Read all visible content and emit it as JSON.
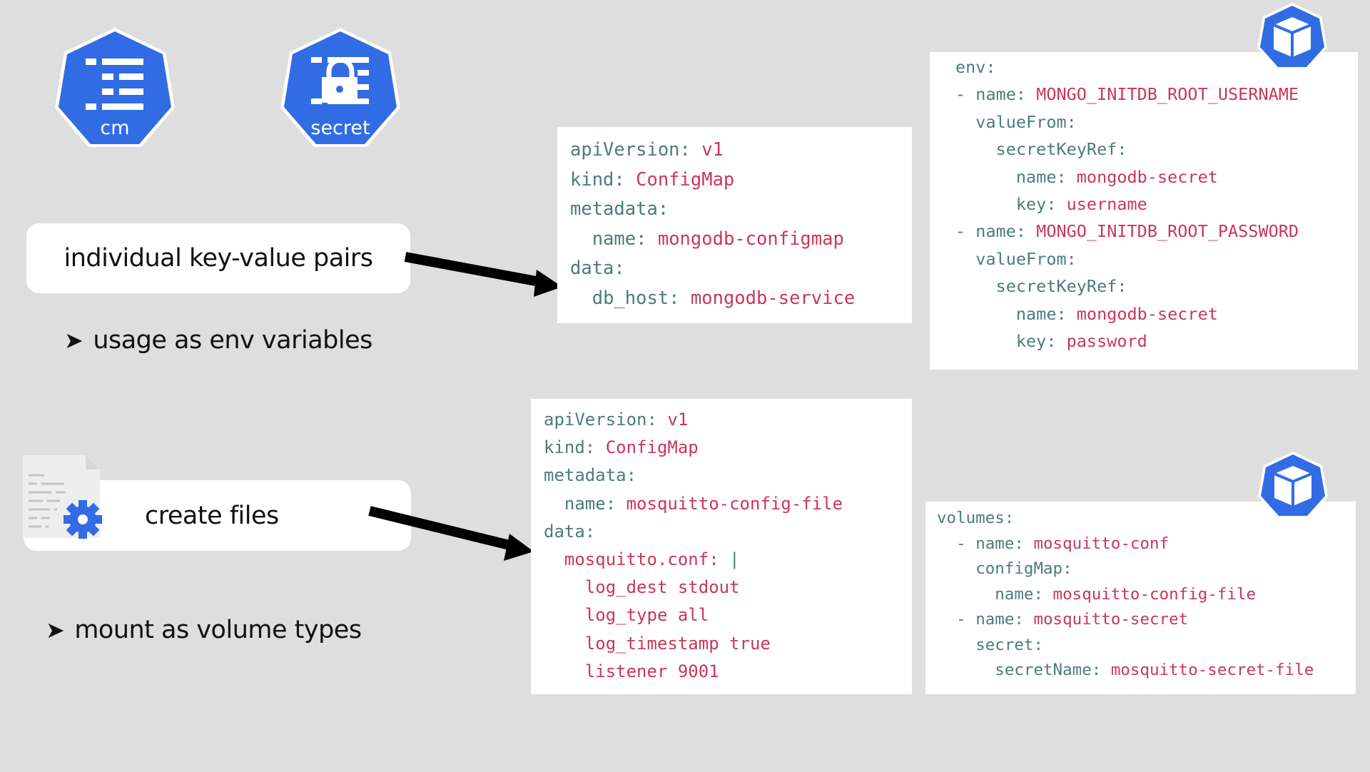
{
  "icons": {
    "configmap": {
      "label": "cm",
      "icon": "configmap-icon"
    },
    "secret": {
      "label": "secret",
      "icon": "secret-lock-icon"
    },
    "pod_top": {
      "icon": "pod-cube-icon"
    },
    "pod_bottom": {
      "icon": "pod-cube-icon"
    },
    "file_gear": {
      "icon": "config-file-gear-icon"
    }
  },
  "colors": {
    "background": "#dedede",
    "k8s_blue": "#326ce5",
    "yaml_key": "#4d7c77",
    "yaml_value": "#c8375c",
    "arrow": "#000000"
  },
  "sections": {
    "key_value": {
      "pill_label": "individual key-value pairs",
      "bullet_marker": "➤",
      "bullet_text": "usage as env variables"
    },
    "files": {
      "pill_label": "create files",
      "bullet_marker": "➤",
      "bullet_text": "mount as volume types"
    }
  },
  "code_blocks": {
    "configmap_kv": [
      {
        "indent": "",
        "key": "apiVersion:",
        "value": " v1"
      },
      {
        "indent": "",
        "key": "kind:",
        "value": " ConfigMap"
      },
      {
        "indent": "",
        "key": "metadata:",
        "value": ""
      },
      {
        "indent": "  ",
        "key": "name:",
        "value": " mongodb-configmap"
      },
      {
        "indent": "",
        "key": "data:",
        "value": ""
      },
      {
        "indent": "  ",
        "key": "db_host:",
        "value": " mongodb-service"
      }
    ],
    "env": [
      {
        "indent": "",
        "key": "env:",
        "value": ""
      },
      {
        "indent": "- ",
        "key": "name:",
        "value": " MONGO_INITDB_ROOT_USERNAME"
      },
      {
        "indent": "  ",
        "key": "valueFrom:",
        "value": ""
      },
      {
        "indent": "    ",
        "key": "secretKeyRef:",
        "value": ""
      },
      {
        "indent": "      ",
        "key": "name:",
        "value": " mongodb-secret"
      },
      {
        "indent": "      ",
        "key": "key:",
        "value": " username"
      },
      {
        "indent": "- ",
        "key": "name:",
        "value": " MONGO_INITDB_ROOT_PASSWORD"
      },
      {
        "indent": "  ",
        "key": "valueFrom:",
        "value": ""
      },
      {
        "indent": "    ",
        "key": "secretKeyRef:",
        "value": ""
      },
      {
        "indent": "      ",
        "key": "name:",
        "value": " mongodb-secret"
      },
      {
        "indent": "      ",
        "key": "key:",
        "value": " password"
      }
    ],
    "configmap_file": [
      {
        "indent": "",
        "key": "apiVersion:",
        "value": " v1"
      },
      {
        "indent": "",
        "key": "kind:",
        "value": " ConfigMap"
      },
      {
        "indent": "",
        "key": "metadata:",
        "value": ""
      },
      {
        "indent": "  ",
        "key": "name:",
        "value": " mosquitto-config-file"
      },
      {
        "indent": "",
        "key": "data:",
        "value": ""
      },
      {
        "indent": "  ",
        "key": "",
        "value": "mosquitto.conf: ",
        "pipe": "|"
      },
      {
        "indent": "    ",
        "key": "",
        "value": "log_dest stdout"
      },
      {
        "indent": "    ",
        "key": "",
        "value": "log_type all"
      },
      {
        "indent": "    ",
        "key": "",
        "value": "log_timestamp true"
      },
      {
        "indent": "    ",
        "key": "",
        "value": "listener 9001"
      }
    ],
    "volumes": [
      {
        "indent": "",
        "key": "volumes:",
        "value": ""
      },
      {
        "indent": "  - ",
        "key": "name:",
        "value": " mosquitto-conf"
      },
      {
        "indent": "    ",
        "key": "configMap:",
        "value": ""
      },
      {
        "indent": "      ",
        "key": "name:",
        "value": " mosquitto-config-file"
      },
      {
        "indent": "  - ",
        "key": "name:",
        "value": " mosquitto-secret"
      },
      {
        "indent": "    ",
        "key": "secret:",
        "value": ""
      },
      {
        "indent": "      ",
        "key": "secretName:",
        "value": " mosquitto-secret-file"
      }
    ]
  }
}
